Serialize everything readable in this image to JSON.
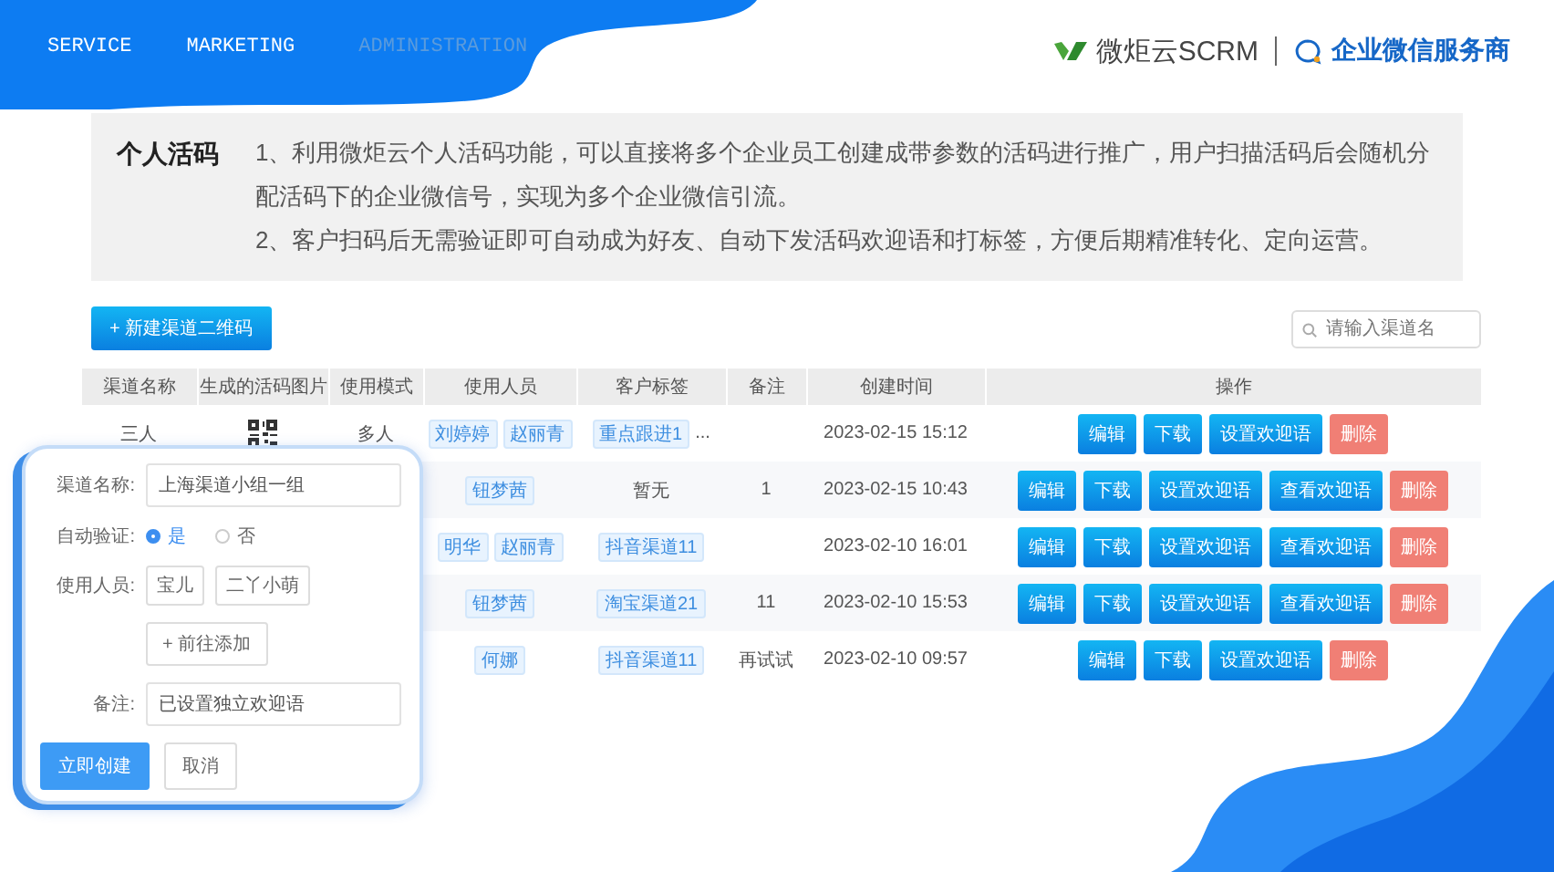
{
  "nav": [
    {
      "label": "SERVICE"
    },
    {
      "label": "MARKETING"
    },
    {
      "label": "ADMINISTRATION"
    }
  ],
  "brand": {
    "name": "微炬云SCRM",
    "tagline": "企业微信服务商"
  },
  "intro": {
    "title": "个人活码",
    "points": [
      "1、利用微炬云个人活码功能，可以直接将多个企业员工创建成带参数的活码进行推广，用户扫描活码后会随机分配活码下的企业微信号，实现为多个企业微信引流。",
      "2、客户扫码后无需验证即可自动成为好友、自动下发活码欢迎语和打标签，方便后期精准转化、定向运营。"
    ]
  },
  "toolbar": {
    "new_button": "+ 新建渠道二维码",
    "search": {
      "placeholder": "请输入渠道名"
    }
  },
  "table": {
    "columns": [
      "渠道名称",
      "生成的活码图片",
      "使用模式",
      "使用人员",
      "客户标签",
      "备注",
      "创建时间",
      "操作"
    ],
    "rows": [
      {
        "name": "三人",
        "qr_code": true,
        "mode": "多人",
        "persons": [
          "刘婷婷",
          "赵丽青"
        ],
        "tags": [
          "重点跟进1"
        ],
        "tags_more": "...",
        "note": "",
        "time": "2023-02-15 15:12",
        "actions": [
          {
            "label": "编辑",
            "kind": "primary"
          },
          {
            "label": "下载",
            "kind": "primary"
          },
          {
            "label": "设置欢迎语",
            "kind": "primary"
          },
          {
            "label": "删除",
            "kind": "danger"
          }
        ]
      },
      {
        "persons": [
          "钮梦茜"
        ],
        "tags": [],
        "tags_text": "暂无",
        "note": "1",
        "time": "2023-02-15 10:43",
        "actions": [
          {
            "label": "编辑",
            "kind": "primary"
          },
          {
            "label": "下载",
            "kind": "primary"
          },
          {
            "label": "设置欢迎语",
            "kind": "primary"
          },
          {
            "label": "查看欢迎语",
            "kind": "primary"
          },
          {
            "label": "删除",
            "kind": "danger"
          }
        ]
      },
      {
        "persons": [
          "明华",
          "赵丽青"
        ],
        "tags": [
          "抖音渠道11"
        ],
        "note": "",
        "time": "2023-02-10 16:01",
        "actions": [
          {
            "label": "编辑",
            "kind": "primary"
          },
          {
            "label": "下载",
            "kind": "primary"
          },
          {
            "label": "设置欢迎语",
            "kind": "primary"
          },
          {
            "label": "查看欢迎语",
            "kind": "primary"
          },
          {
            "label": "删除",
            "kind": "danger"
          }
        ]
      },
      {
        "persons": [
          "钮梦茜"
        ],
        "tags": [
          "淘宝渠道21"
        ],
        "note": "11",
        "time": "2023-02-10 15:53",
        "actions": [
          {
            "label": "编辑",
            "kind": "primary"
          },
          {
            "label": "下载",
            "kind": "primary"
          },
          {
            "label": "设置欢迎语",
            "kind": "primary"
          },
          {
            "label": "查看欢迎语",
            "kind": "primary"
          },
          {
            "label": "删除",
            "kind": "danger"
          }
        ]
      },
      {
        "persons": [
          "何娜"
        ],
        "tags": [
          "抖音渠道11"
        ],
        "note": "再试试",
        "time": "2023-02-10 09:57",
        "actions": [
          {
            "label": "编辑",
            "kind": "primary"
          },
          {
            "label": "下载",
            "kind": "primary"
          },
          {
            "label": "设置欢迎语",
            "kind": "primary"
          },
          {
            "label": "删除",
            "kind": "danger"
          }
        ]
      }
    ]
  },
  "popup": {
    "name_label": "渠道名称:",
    "name_value": "上海渠道小组一组",
    "verify_label": "自动验证:",
    "verify_options": [
      {
        "label": "是",
        "selected": true
      },
      {
        "label": "否",
        "selected": false
      }
    ],
    "persons_label": "使用人员:",
    "persons": [
      "宝儿",
      "二丫小萌"
    ],
    "add_button": "+ 前往添加",
    "note_label": "备注:",
    "note_value": "已设置独立欢迎语",
    "buttons": [
      {
        "label": "立即创建",
        "kind": "primary"
      },
      {
        "label": "取消",
        "kind": "default"
      }
    ]
  }
}
